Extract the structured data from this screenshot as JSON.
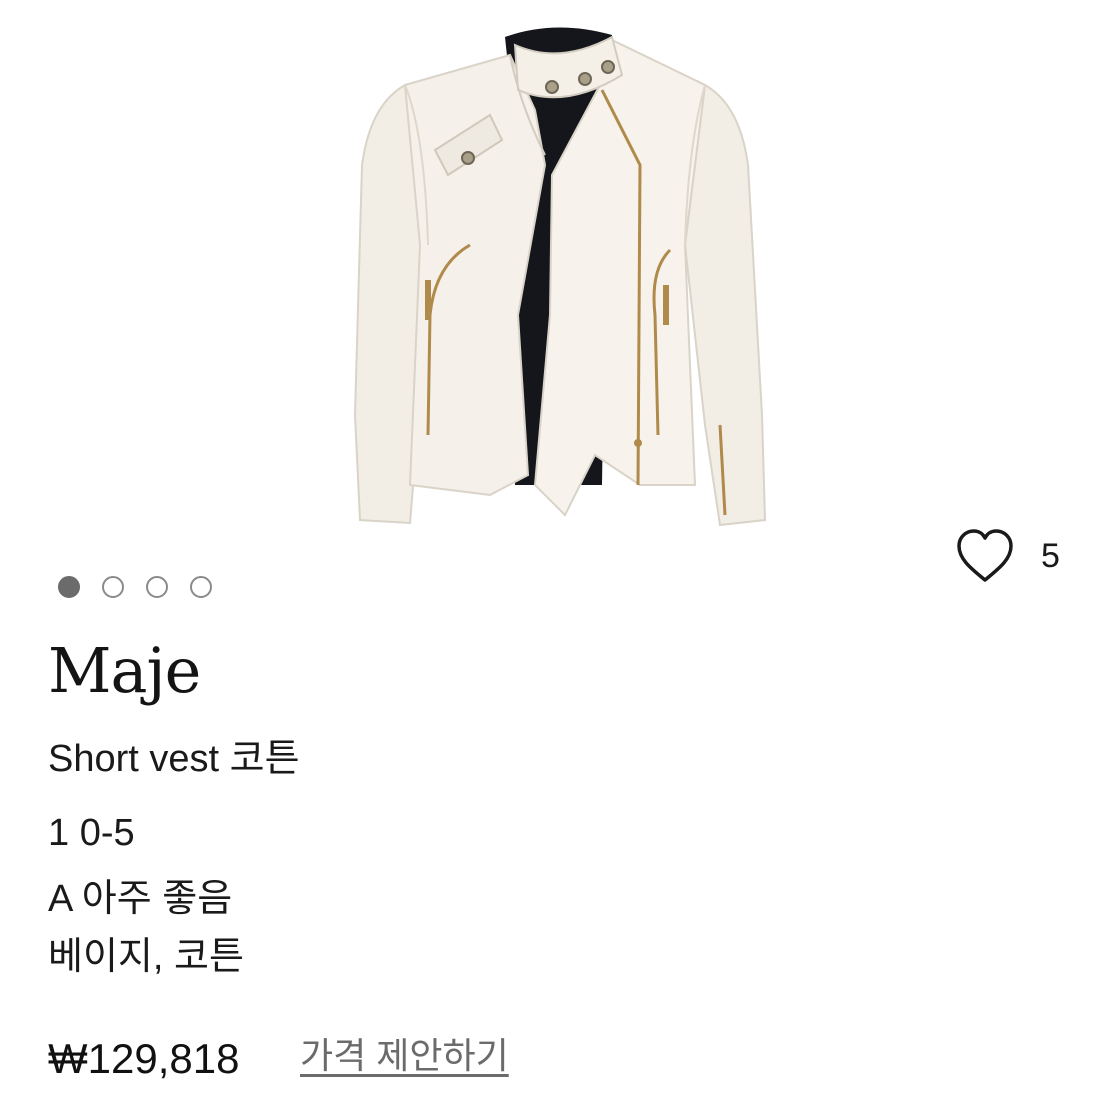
{
  "product": {
    "brand": "Maje",
    "title": "Short vest 코튼",
    "size": "1 0-5",
    "condition": "A 아주 좋음",
    "color_material": "베이지, 코튼",
    "price": "₩129,818",
    "offer_label": "가격 제안하기"
  },
  "likes": {
    "count": "5",
    "icon": "heart-outline-icon"
  },
  "gallery": {
    "total_images": 4,
    "active_index": 0
  },
  "colors": {
    "jacket": "#f4f0e8",
    "zipper": "#b08a4a",
    "lining": "#15161c",
    "dot_active": "#6b6b6b",
    "dot_inactive": "#8a8a8a",
    "link": "#6b6b6b"
  }
}
